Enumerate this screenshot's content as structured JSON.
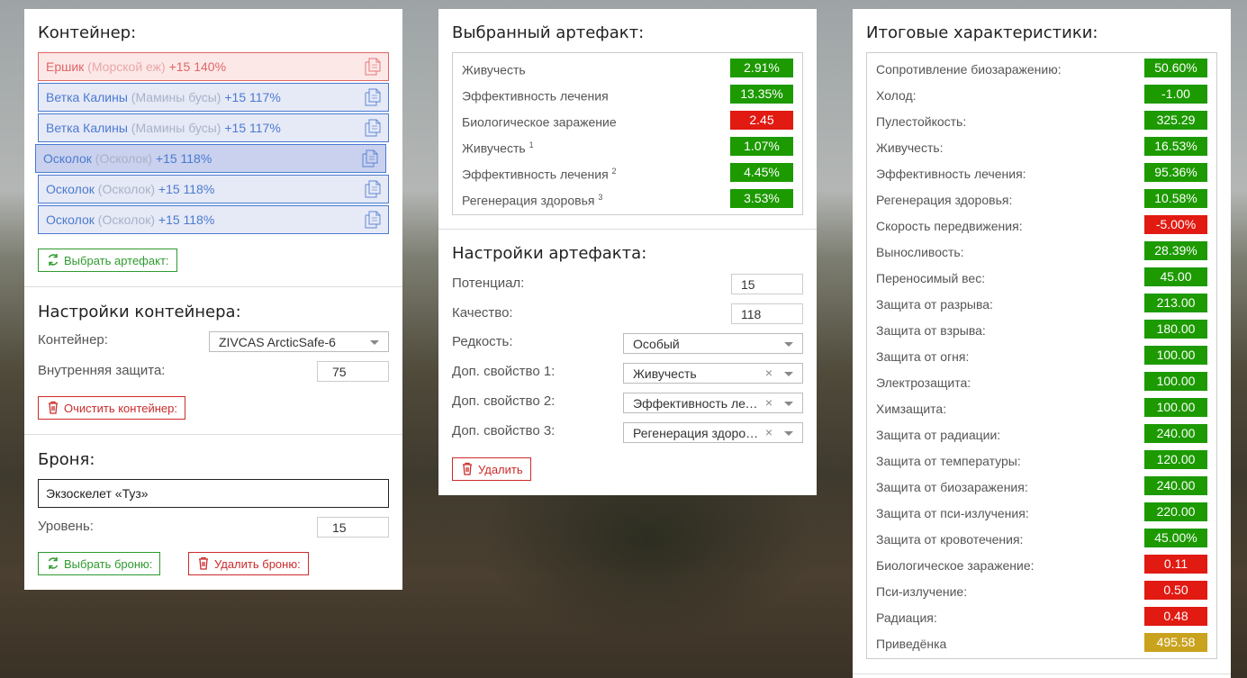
{
  "container": {
    "title": "Контейнер:",
    "slots": [
      {
        "name": "Ершик",
        "sub": "(Морской еж)",
        "level": "+15 140%",
        "style": "red"
      },
      {
        "name": "Ветка Калины",
        "sub": "(Мамины бусы)",
        "level": "+15 117%",
        "style": "blue"
      },
      {
        "name": "Ветка Калины",
        "sub": "(Мамины бусы)",
        "level": "+15 117%",
        "style": "blue"
      },
      {
        "name": "Осколок",
        "sub": "(Осколок)",
        "level": "+15 118%",
        "style": "selected"
      },
      {
        "name": "Осколок",
        "sub": "(Осколок)",
        "level": "+15 118%",
        "style": "blue"
      },
      {
        "name": "Осколок",
        "sub": "(Осколок)",
        "level": "+15 118%",
        "style": "blue"
      }
    ],
    "choose_button": "Выбрать артефакт:"
  },
  "container_settings": {
    "title": "Настройки контейнера:",
    "container_label": "Контейнер:",
    "container_value": "ZIVCAS ArcticSafe-6",
    "protection_label": "Внутренняя защита:",
    "protection_value": "75",
    "clear_button": "Очистить контейнер:"
  },
  "armor": {
    "title": "Броня:",
    "value": "Экзоскелет «Туз»",
    "level_label": "Уровень:",
    "level_value": "15",
    "choose_button": "Выбрать броню:",
    "delete_button": "Удалить броню:"
  },
  "selected_artifact": {
    "title": "Выбранный артефакт:",
    "stats": [
      {
        "name": "Живучесть",
        "sup": "",
        "value": "2.91%",
        "color": "green"
      },
      {
        "name": "Эффективность лечения",
        "sup": "",
        "value": "13.35%",
        "color": "green"
      },
      {
        "name": "Биологическое заражение",
        "sup": "",
        "value": "2.45",
        "color": "red"
      },
      {
        "name": "Живучесть",
        "sup": "1",
        "value": "1.07%",
        "color": "green"
      },
      {
        "name": "Эффективность лечения",
        "sup": "2",
        "value": "4.45%",
        "color": "green"
      },
      {
        "name": "Регенерация здоровья",
        "sup": "3",
        "value": "3.53%",
        "color": "green"
      }
    ]
  },
  "artifact_settings": {
    "title": "Настройки артефакта:",
    "potential_label": "Потенциал:",
    "potential_value": "15",
    "quality_label": "Качество:",
    "quality_value": "118",
    "rarity_label": "Редкость:",
    "rarity_value": "Особый",
    "extra1_label": "Доп. свойство 1:",
    "extra1_value": "Живучесть",
    "extra2_label": "Доп. свойство 2:",
    "extra2_value": "Эффективность лечения",
    "extra3_label": "Доп. свойство 3:",
    "extra3_value": "Регенерация здоровья",
    "clear_symbol": "×",
    "delete_button": "Удалить"
  },
  "totals": {
    "title": "Итоговые характеристики:",
    "stats": [
      {
        "name": "Сопротивление биозаражению:",
        "value": "50.60%",
        "color": "green"
      },
      {
        "name": "Холод:",
        "value": "-1.00",
        "color": "green"
      },
      {
        "name": "Пулестойкость:",
        "value": "325.29",
        "color": "green"
      },
      {
        "name": "Живучесть:",
        "value": "16.53%",
        "color": "green"
      },
      {
        "name": "Эффективность лечения:",
        "value": "95.36%",
        "color": "green"
      },
      {
        "name": "Регенерация здоровья:",
        "value": "10.58%",
        "color": "green"
      },
      {
        "name": "Скорость передвижения:",
        "value": "-5.00%",
        "color": "red"
      },
      {
        "name": "Выносливость:",
        "value": "28.39%",
        "color": "green"
      },
      {
        "name": "Переносимый вес:",
        "value": "45.00",
        "color": "green"
      },
      {
        "name": "Защита от разрыва:",
        "value": "213.00",
        "color": "green"
      },
      {
        "name": "Защита от взрыва:",
        "value": "180.00",
        "color": "green"
      },
      {
        "name": "Защита от огня:",
        "value": "100.00",
        "color": "green"
      },
      {
        "name": "Электрозащита:",
        "value": "100.00",
        "color": "green"
      },
      {
        "name": "Химзащита:",
        "value": "100.00",
        "color": "green"
      },
      {
        "name": "Защита от радиации:",
        "value": "240.00",
        "color": "green"
      },
      {
        "name": "Защита от температуры:",
        "value": "120.00",
        "color": "green"
      },
      {
        "name": "Защита от биозаражения:",
        "value": "240.00",
        "color": "green"
      },
      {
        "name": "Защита от пси-излучения:",
        "value": "220.00",
        "color": "green"
      },
      {
        "name": "Защита от кровотечения:",
        "value": "45.00%",
        "color": "green"
      },
      {
        "name": "Биологическое заражение:",
        "value": "0.11",
        "color": "red"
      },
      {
        "name": "Пси-излучение:",
        "value": "0.50",
        "color": "red"
      },
      {
        "name": "Радиация:",
        "value": "0.48",
        "color": "red"
      },
      {
        "name": "Приведёнка",
        "value": "495.58",
        "color": "yellow"
      }
    ]
  },
  "colors": {
    "green": "#1c9a00",
    "red": "#e11a12",
    "yellow": "#c9a21e",
    "slot_blue": "#4a7bd0",
    "slot_red": "#e06666"
  }
}
